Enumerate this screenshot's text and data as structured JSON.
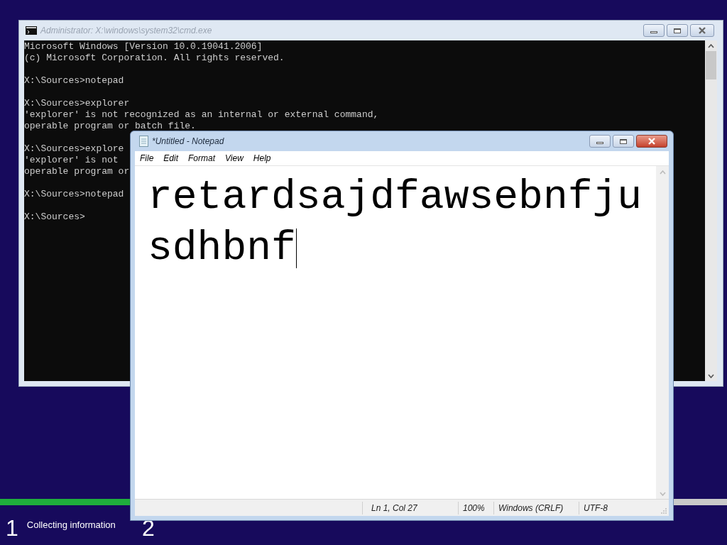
{
  "setup": {
    "progress": {
      "level": 0.45
    },
    "steps": [
      {
        "number": "1",
        "label": "Collecting information"
      },
      {
        "number": "2"
      }
    ]
  },
  "console_window": {
    "title": "Administrator: X:\\windows\\system32\\cmd.exe",
    "blocks": [
      [
        "Microsoft Windows [Version 10.0.19041.2006]",
        "(c) Microsoft Corporation. All rights reserved."
      ],
      [
        "X:\\Sources>notepad"
      ],
      [
        "X:\\Sources>explorer",
        "'explorer' is not recognized as an internal or external command,",
        "operable program or batch file."
      ],
      [
        "X:\\Sources>explore",
        "'explorer' is not",
        "operable program or"
      ],
      [
        "X:\\Sources>notepad"
      ],
      [
        "X:\\Sources>"
      ]
    ]
  },
  "notepad": {
    "title": "*Untitled - Notepad",
    "menu": [
      "File",
      "Edit",
      "Format",
      "View",
      "Help"
    ],
    "text_lines": [
      "retardsajdfawsebnfju",
      "sdhbnf"
    ],
    "status_bar": [
      "Ln 1, Col 27",
      "100%",
      "Windows (CRLF)",
      "UTF-8"
    ]
  }
}
